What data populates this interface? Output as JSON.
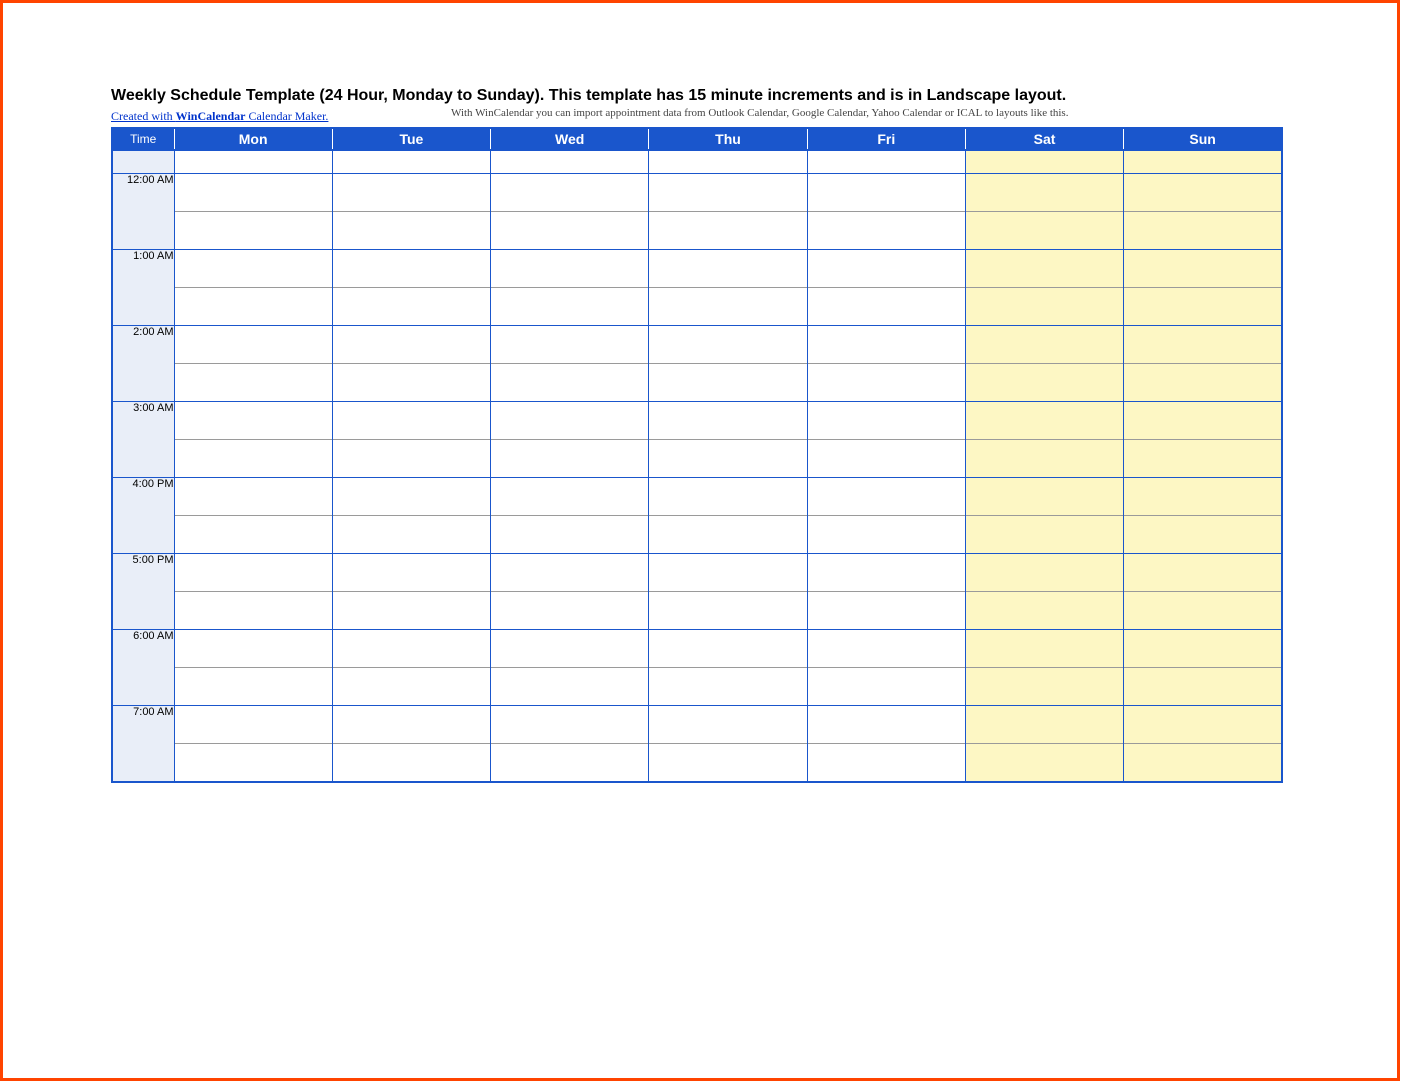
{
  "title": "Weekly Schedule Template (24 Hour, Monday to Sunday).  This template has 15 minute increments and is in Landscape layout.",
  "credit": {
    "prefix": "Created with ",
    "brand": "WinCalendar",
    "suffix": " Calendar Maker."
  },
  "note": "With WinCalendar you can import appointment data from Outlook Calendar, Google Calendar, Yahoo Calendar or ICAL to layouts like this.",
  "header": {
    "time": "Time",
    "days": [
      "Mon",
      "Tue",
      "Wed",
      "Thu",
      "Fri",
      "Sat",
      "Sun"
    ]
  },
  "time_slots": [
    "12:00 AM",
    "1:00 AM",
    "2:00 AM",
    "3:00 AM",
    "4:00 PM",
    "5:00 PM",
    "6:00 AM",
    "7:00 AM"
  ],
  "weekend_indexes": [
    5,
    6
  ]
}
